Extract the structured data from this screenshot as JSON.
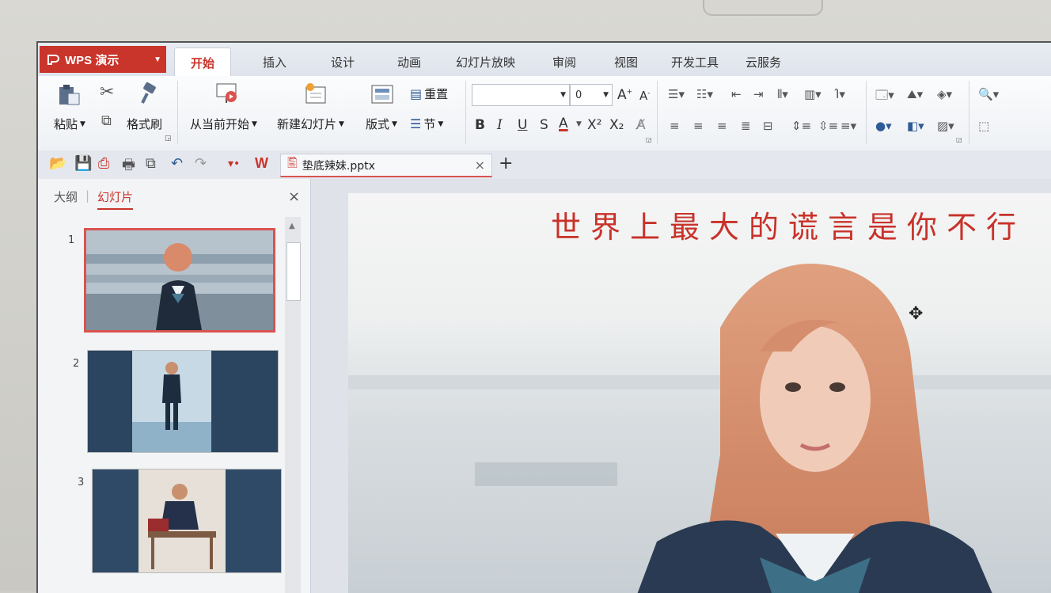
{
  "app": {
    "menu_label": "WPS 演示"
  },
  "tabs": [
    "开始",
    "插入",
    "设计",
    "动画",
    "幻灯片放映",
    "审阅",
    "视图",
    "开发工具",
    "云服务"
  ],
  "ribbon": {
    "paste": "粘贴",
    "format_painter": "格式刷",
    "from_current": "从当前开始",
    "new_slide": "新建幻灯片",
    "layout": "版式",
    "reset": "重置",
    "section": "节",
    "font_size": "0",
    "bold": "B",
    "italic": "I",
    "underline": "U",
    "strike": "S",
    "font_color": "A",
    "superscript": "X²",
    "subscript": "X₂"
  },
  "doc": {
    "filename": "垫底辣妹.pptx"
  },
  "panel": {
    "tab_outline": "大纲",
    "tab_slides": "幻灯片",
    "slide_numbers": [
      "1",
      "2",
      "3"
    ]
  },
  "slide": {
    "title": "世界上最大的谎言是你不行"
  },
  "colors": {
    "accent": "#c9342b",
    "title": "#c8322a"
  }
}
